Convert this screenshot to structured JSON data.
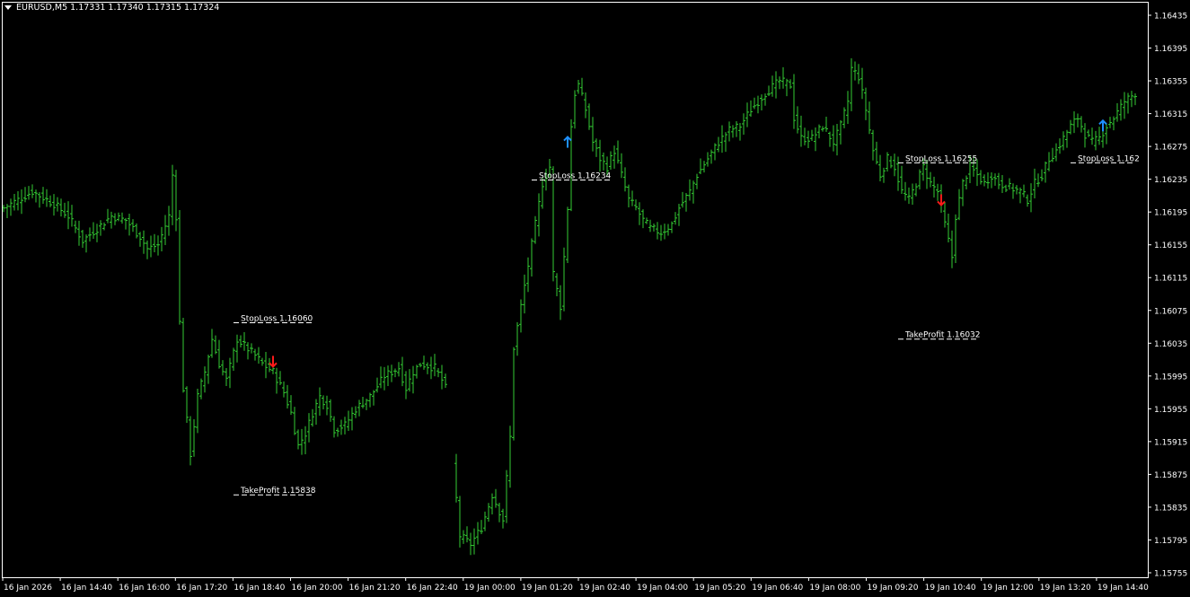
{
  "header": {
    "symbol": "EURUSD,M5",
    "ohlc": "1.17331 1.17340 1.17315 1.17324"
  },
  "colors": {
    "background": "#000000",
    "bars": "#33cc33",
    "frame": "#ffffff",
    "text": "#ffffff",
    "sell_arrow": "#ff1a1a",
    "buy_arrow": "#1e90ff",
    "level_line": "#ffffff"
  },
  "chart_data": {
    "type": "ohlc",
    "timeframe": "M5",
    "y_ticks": [
      "1.16435",
      "1.16395",
      "1.16355",
      "1.16315",
      "1.16275",
      "1.16235",
      "1.16195",
      "1.16155",
      "1.16115",
      "1.16075",
      "1.16035",
      "1.15995",
      "1.15955",
      "1.15915",
      "1.15875",
      "1.15835",
      "1.15795",
      "1.15755"
    ],
    "x_ticks": [
      "16 Jan 2026",
      "16 Jan 14:40",
      "16 Jan 16:00",
      "16 Jan 17:20",
      "16 Jan 18:40",
      "16 Jan 20:00",
      "16 Jan 21:20",
      "16 Jan 22:40",
      "19 Jan 00:00",
      "19 Jan 01:20",
      "19 Jan 02:40",
      "19 Jan 04:00",
      "19 Jan 05:20",
      "19 Jan 06:40",
      "19 Jan 08:00",
      "19 Jan 09:20",
      "19 Jan 10:40",
      "19 Jan 12:00",
      "19 Jan 13:20",
      "19 Jan 14:40"
    ],
    "ylim": [
      1.15745,
      1.16445
    ],
    "bar_count": 316,
    "anchors": [
      [
        0,
        1.162
      ],
      [
        4,
        1.1621
      ],
      [
        8,
        1.1622
      ],
      [
        14,
        1.16205
      ],
      [
        18,
        1.1619
      ],
      [
        22,
        1.1616
      ],
      [
        26,
        1.16175
      ],
      [
        30,
        1.1619
      ],
      [
        34,
        1.16185
      ],
      [
        38,
        1.16165
      ],
      [
        40,
        1.1615
      ],
      [
        43,
        1.16155
      ],
      [
        46,
        1.1619
      ],
      [
        47,
        1.1624
      ],
      [
        48,
        1.1619
      ],
      [
        49,
        1.1606
      ],
      [
        50,
        1.1598
      ],
      [
        52,
        1.159
      ],
      [
        54,
        1.1597
      ],
      [
        56,
        1.16
      ],
      [
        58,
        1.1604
      ],
      [
        60,
        1.1601
      ],
      [
        62,
        1.1599
      ],
      [
        65,
        1.1604
      ],
      [
        70,
        1.1602
      ],
      [
        72,
        1.1601
      ],
      [
        75,
        1.16
      ],
      [
        78,
        1.15975
      ],
      [
        80,
        1.1595
      ],
      [
        82,
        1.1591
      ],
      [
        84,
        1.15925
      ],
      [
        86,
        1.1595
      ],
      [
        88,
        1.1597
      ],
      [
        90,
        1.1596
      ],
      [
        92,
        1.1593
      ],
      [
        95,
        1.15935
      ],
      [
        98,
        1.15955
      ],
      [
        102,
        1.1597
      ],
      [
        106,
        1.15995
      ],
      [
        110,
        1.16005
      ],
      [
        112,
        1.1598
      ],
      [
        114,
        1.16
      ],
      [
        116,
        1.1601
      ],
      [
        120,
        1.16005
      ],
      [
        122,
        1.1599
      ],
      [
        123,
        1.1598
      ],
      [
        127,
        1.158
      ],
      [
        130,
        1.1579
      ],
      [
        133,
        1.1581
      ],
      [
        136,
        1.1585
      ],
      [
        139,
        1.1582
      ],
      [
        141,
        1.1592
      ],
      [
        142,
        1.1603
      ],
      [
        144,
        1.1608
      ],
      [
        146,
        1.1613
      ],
      [
        148,
        1.1618
      ],
      [
        150,
        1.1623
      ],
      [
        152,
        1.1625
      ],
      [
        153,
        1.1612
      ],
      [
        155,
        1.1608
      ],
      [
        157,
        1.162
      ],
      [
        158,
        1.163
      ],
      [
        159,
        1.1634
      ],
      [
        160,
        1.1635
      ],
      [
        162,
        1.1632
      ],
      [
        164,
        1.1628
      ],
      [
        166,
        1.1626
      ],
      [
        168,
        1.1625
      ],
      [
        170,
        1.1627
      ],
      [
        172,
        1.1624
      ],
      [
        174,
        1.1621
      ],
      [
        176,
        1.162
      ],
      [
        178,
        1.16185
      ],
      [
        180,
        1.16175
      ],
      [
        183,
        1.1617
      ],
      [
        186,
        1.1618
      ],
      [
        188,
        1.162
      ],
      [
        191,
        1.1622
      ],
      [
        193,
        1.1624
      ],
      [
        196,
        1.1626
      ],
      [
        199,
        1.1628
      ],
      [
        202,
        1.16295
      ],
      [
        205,
        1.163
      ],
      [
        208,
        1.1632
      ],
      [
        212,
        1.1634
      ],
      [
        216,
        1.16355
      ],
      [
        219,
        1.1635
      ],
      [
        220,
        1.1631
      ],
      [
        222,
        1.16285
      ],
      [
        225,
        1.16285
      ],
      [
        228,
        1.163
      ],
      [
        231,
        1.1628
      ],
      [
        233,
        1.163
      ],
      [
        235,
        1.1633
      ],
      [
        236,
        1.1637
      ],
      [
        238,
        1.1636
      ],
      [
        240,
        1.1632
      ],
      [
        242,
        1.1627
      ],
      [
        244,
        1.1624
      ],
      [
        246,
        1.1626
      ],
      [
        248,
        1.1625
      ],
      [
        250,
        1.1622
      ],
      [
        252,
        1.1621
      ],
      [
        254,
        1.1623
      ],
      [
        256,
        1.1625
      ],
      [
        258,
        1.1623
      ],
      [
        260,
        1.1622
      ],
      [
        262,
        1.1618
      ],
      [
        264,
        1.1614
      ],
      [
        265,
        1.1619
      ],
      [
        267,
        1.1623
      ],
      [
        269,
        1.1625
      ],
      [
        271,
        1.1624
      ],
      [
        273,
        1.1623
      ],
      [
        275,
        1.1624
      ],
      [
        277,
        1.1623
      ],
      [
        280,
        1.16225
      ],
      [
        283,
        1.1622
      ],
      [
        285,
        1.1621
      ],
      [
        287,
        1.1623
      ],
      [
        289,
        1.1624
      ],
      [
        291,
        1.1626
      ],
      [
        293,
        1.1627
      ],
      [
        295,
        1.16285
      ],
      [
        297,
        1.163
      ],
      [
        299,
        1.1631
      ],
      [
        301,
        1.1629
      ],
      [
        303,
        1.1628
      ],
      [
        305,
        1.16285
      ],
      [
        307,
        1.163
      ],
      [
        309,
        1.1631
      ],
      [
        312,
        1.1633
      ],
      [
        315,
        1.1634
      ]
    ],
    "signals": [
      {
        "type": "sell",
        "bar": 75,
        "price": 1.16013
      },
      {
        "type": "buy",
        "bar": 157,
        "price": 1.1628
      },
      {
        "type": "sell",
        "bar": 261,
        "price": 1.1621
      },
      {
        "type": "buy",
        "bar": 306,
        "price": 1.163
      }
    ],
    "levels": [
      {
        "label": "StopLoss 1.16060",
        "price": 1.1606,
        "bar_start": 64,
        "bar_end": 86
      },
      {
        "label": "TakeProfit 1.15838",
        "price": 1.1585,
        "bar_start": 64,
        "bar_end": 86
      },
      {
        "label": "StopLoss 1.16234",
        "price": 1.16234,
        "bar_start": 147,
        "bar_end": 169
      },
      {
        "label": "StopLoss 1.16255",
        "price": 1.16255,
        "bar_start": 249,
        "bar_end": 271
      },
      {
        "label": "TakeProfit 1.16032",
        "price": 1.1604,
        "bar_start": 249,
        "bar_end": 271
      },
      {
        "label": "StopLoss 1.162",
        "price": 1.16255,
        "bar_start": 297,
        "bar_end": 315
      }
    ]
  }
}
